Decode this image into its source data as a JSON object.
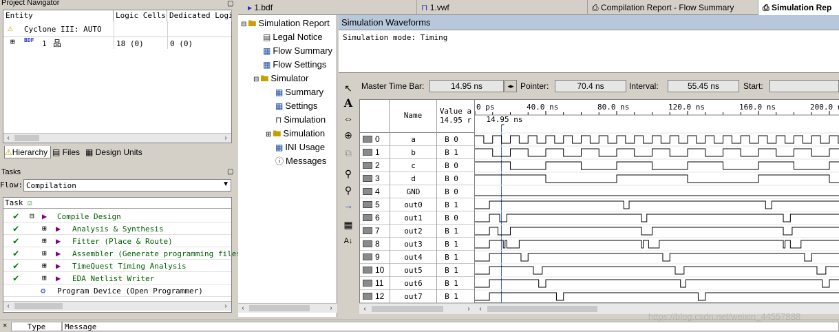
{
  "project_navigator": {
    "title": "Project Navigator",
    "columns": [
      "Entity",
      "Logic Cells",
      "Dedicated Logic"
    ],
    "rows": [
      {
        "entity": "Cyclone III: AUTO",
        "logic_cells": "",
        "dedicated": ""
      },
      {
        "entity": "1",
        "logic_cells": "18 (0)",
        "dedicated": "0 (0)"
      }
    ],
    "tabs": [
      "Hierarchy",
      "Files",
      "Design Units"
    ]
  },
  "tasks": {
    "title": "Tasks",
    "flow_label": "Flow:",
    "flow_value": "Compilation",
    "task_header": "Task",
    "items": [
      {
        "label": "Compile Design",
        "done": true
      },
      {
        "label": "Analysis & Synthesis",
        "done": true
      },
      {
        "label": "Fitter (Place & Route)",
        "done": true
      },
      {
        "label": "Assembler (Generate programming files)",
        "done": true
      },
      {
        "label": "TimeQuest Timing Analysis",
        "done": true
      },
      {
        "label": "EDA Netlist Writer",
        "done": true
      },
      {
        "label": "Program Device (Open Programmer)",
        "done": false
      }
    ]
  },
  "report_tree": [
    {
      "label": "Simulation Report",
      "level": 0
    },
    {
      "label": "Legal Notice",
      "level": 1
    },
    {
      "label": "Flow Summary",
      "level": 1
    },
    {
      "label": "Flow Settings",
      "level": 1
    },
    {
      "label": "Simulator",
      "level": 1
    },
    {
      "label": "Summary",
      "level": 2
    },
    {
      "label": "Settings",
      "level": 2
    },
    {
      "label": "Simulation",
      "level": 2
    },
    {
      "label": "Simulation",
      "level": 2
    },
    {
      "label": "INI Usage",
      "level": 2
    },
    {
      "label": "Messages",
      "level": 2
    }
  ],
  "tabs": [
    {
      "label": "1.bdf",
      "active": false
    },
    {
      "label": "1.vwf",
      "active": false
    },
    {
      "label": "Compilation Report - Flow Summary",
      "active": false
    },
    {
      "label": "Simulation Rep",
      "active": true
    }
  ],
  "waveforms": {
    "header": "Simulation Waveforms",
    "mode_text": "Simulation mode: Timing",
    "master_time_bar_label": "Master Time Bar:",
    "master_time_bar_value": "14.95 ns",
    "pointer_label": "Pointer:",
    "pointer_value": "70.4 ns",
    "interval_label": "Interval:",
    "interval_value": "55.45 ns",
    "start_label": "Start:",
    "start_value": "",
    "col_name": "Name",
    "col_value_line1": "Value a",
    "col_value_line2": "14.95 r",
    "marker_label": "14.95 ns",
    "time_ticks": [
      "0 ps",
      "40.0 ns",
      "80.0 ns",
      "120.0 ns",
      "160.0 ns",
      "200.0 ns"
    ],
    "signals": [
      {
        "idx": "0",
        "name": "a",
        "value": "B 0"
      },
      {
        "idx": "1",
        "name": "b",
        "value": "B 1"
      },
      {
        "idx": "2",
        "name": "c",
        "value": "B 0"
      },
      {
        "idx": "3",
        "name": "d",
        "value": "B 0"
      },
      {
        "idx": "4",
        "name": "GND",
        "value": "B 0"
      },
      {
        "idx": "5",
        "name": "out0",
        "value": "B 1"
      },
      {
        "idx": "6",
        "name": "out1",
        "value": "B 0"
      },
      {
        "idx": "7",
        "name": "out2",
        "value": "B 1"
      },
      {
        "idx": "8",
        "name": "out3",
        "value": "B 1"
      },
      {
        "idx": "9",
        "name": "out4",
        "value": "B 1"
      },
      {
        "idx": "10",
        "name": "out5",
        "value": "B 1"
      },
      {
        "idx": "11",
        "name": "out6",
        "value": "B 1"
      },
      {
        "idx": "12",
        "name": "out7",
        "value": "B 1"
      }
    ]
  },
  "messages": {
    "col_type": "Type",
    "col_message": "Message"
  },
  "watermark": "https://blog.csdn.net/weixin_44557888"
}
